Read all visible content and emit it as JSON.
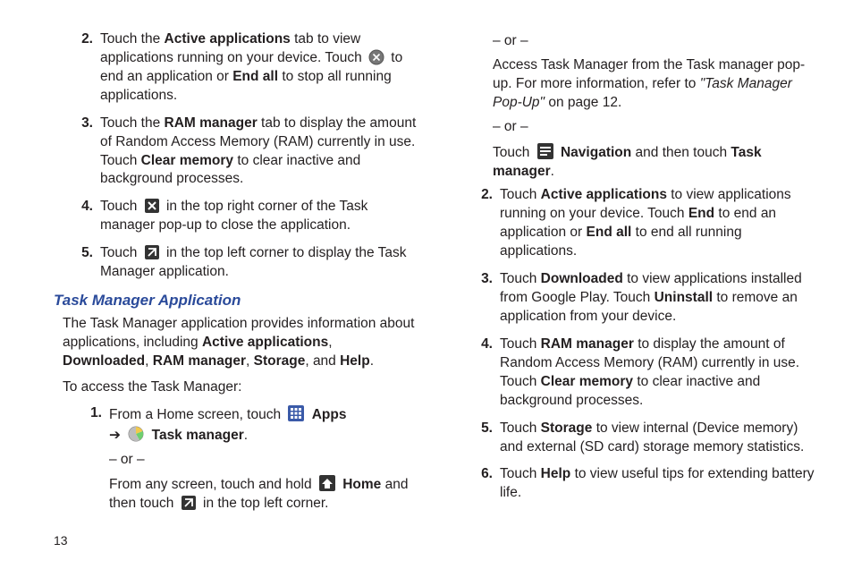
{
  "page_number": "13",
  "left": {
    "items": [
      {
        "num": "2.",
        "p1a": "Touch the ",
        "p1b": "Active applications",
        "p1c": " tab to view applications running on your device. Touch ",
        "p1d": " to end an application or ",
        "p1e": "End all",
        "p1f": " to stop all running applications."
      },
      {
        "num": "3.",
        "p1a": "Touch the ",
        "p1b": "RAM manager",
        "p1c": " tab to display the amount of Random Access Memory (RAM) currently in use. Touch ",
        "p1d": "Clear memory",
        "p1e": " to clear inactive and background processes."
      },
      {
        "num": "4.",
        "p1a": "Touch ",
        "p1b": " in the top right corner of the Task manager pop-up to close the application."
      },
      {
        "num": "5.",
        "p1a": "Touch ",
        "p1b": " in the top left corner to display the Task Manager application."
      }
    ],
    "section_heading": "Task Manager Application",
    "intro_a": "The Task Manager application provides information about applications, including ",
    "intro_b": "Active applications",
    "intro_c": ", ",
    "intro_d": "Downloaded",
    "intro_e": ", ",
    "intro_f": "RAM manager",
    "intro_g": ", ",
    "intro_h": "Storage",
    "intro_i": ", and ",
    "intro_j": "Help",
    "intro_k": ".",
    "access_line": "To access the Task Manager:",
    "step1": {
      "num": "1.",
      "a": "From a Home screen, touch ",
      "apps": "Apps",
      "arrow": "➔",
      "tm": "Task manager",
      "dot": ".",
      "or1": "– or –",
      "b1": "From any screen, touch and hold ",
      "home": "Home",
      "b2": " and then touch ",
      "b3": " in the top left corner."
    }
  },
  "right": {
    "cont": {
      "or1": "– or –",
      "c1": "Access Task Manager from the Task manager pop-up. For more information, refer to ",
      "ref": "\"Task Manager Pop-Up\"",
      "c2": " on page 12.",
      "or2": "– or –",
      "d1": "Touch ",
      "nav": "Navigation",
      "d2": " and then touch ",
      "tm": "Task manager",
      "dot": "."
    },
    "items": [
      {
        "num": "2.",
        "a": "Touch ",
        "b": "Active applications",
        "c": " to view applications running on your device. Touch ",
        "d": "End",
        "e": " to end an application or ",
        "f": "End all",
        "g": " to end all running applications."
      },
      {
        "num": "3.",
        "a": "Touch ",
        "b": "Downloaded",
        "c": " to view applications installed from Google Play. Touch ",
        "d": "Uninstall",
        "e": " to remove an application from your device."
      },
      {
        "num": "4.",
        "a": "Touch ",
        "b": "RAM manager",
        "c": " to display the amount of Random Access Memory (RAM) currently in use. Touch ",
        "d": "Clear memory",
        "e": " to clear inactive and background processes."
      },
      {
        "num": "5.",
        "a": "Touch ",
        "b": "Storage",
        "c": " to view internal (Device memory) and external (SD card) storage memory statistics."
      },
      {
        "num": "6.",
        "a": "Touch ",
        "b": "Help",
        "c": " to view useful tips for extending battery life."
      }
    ]
  }
}
